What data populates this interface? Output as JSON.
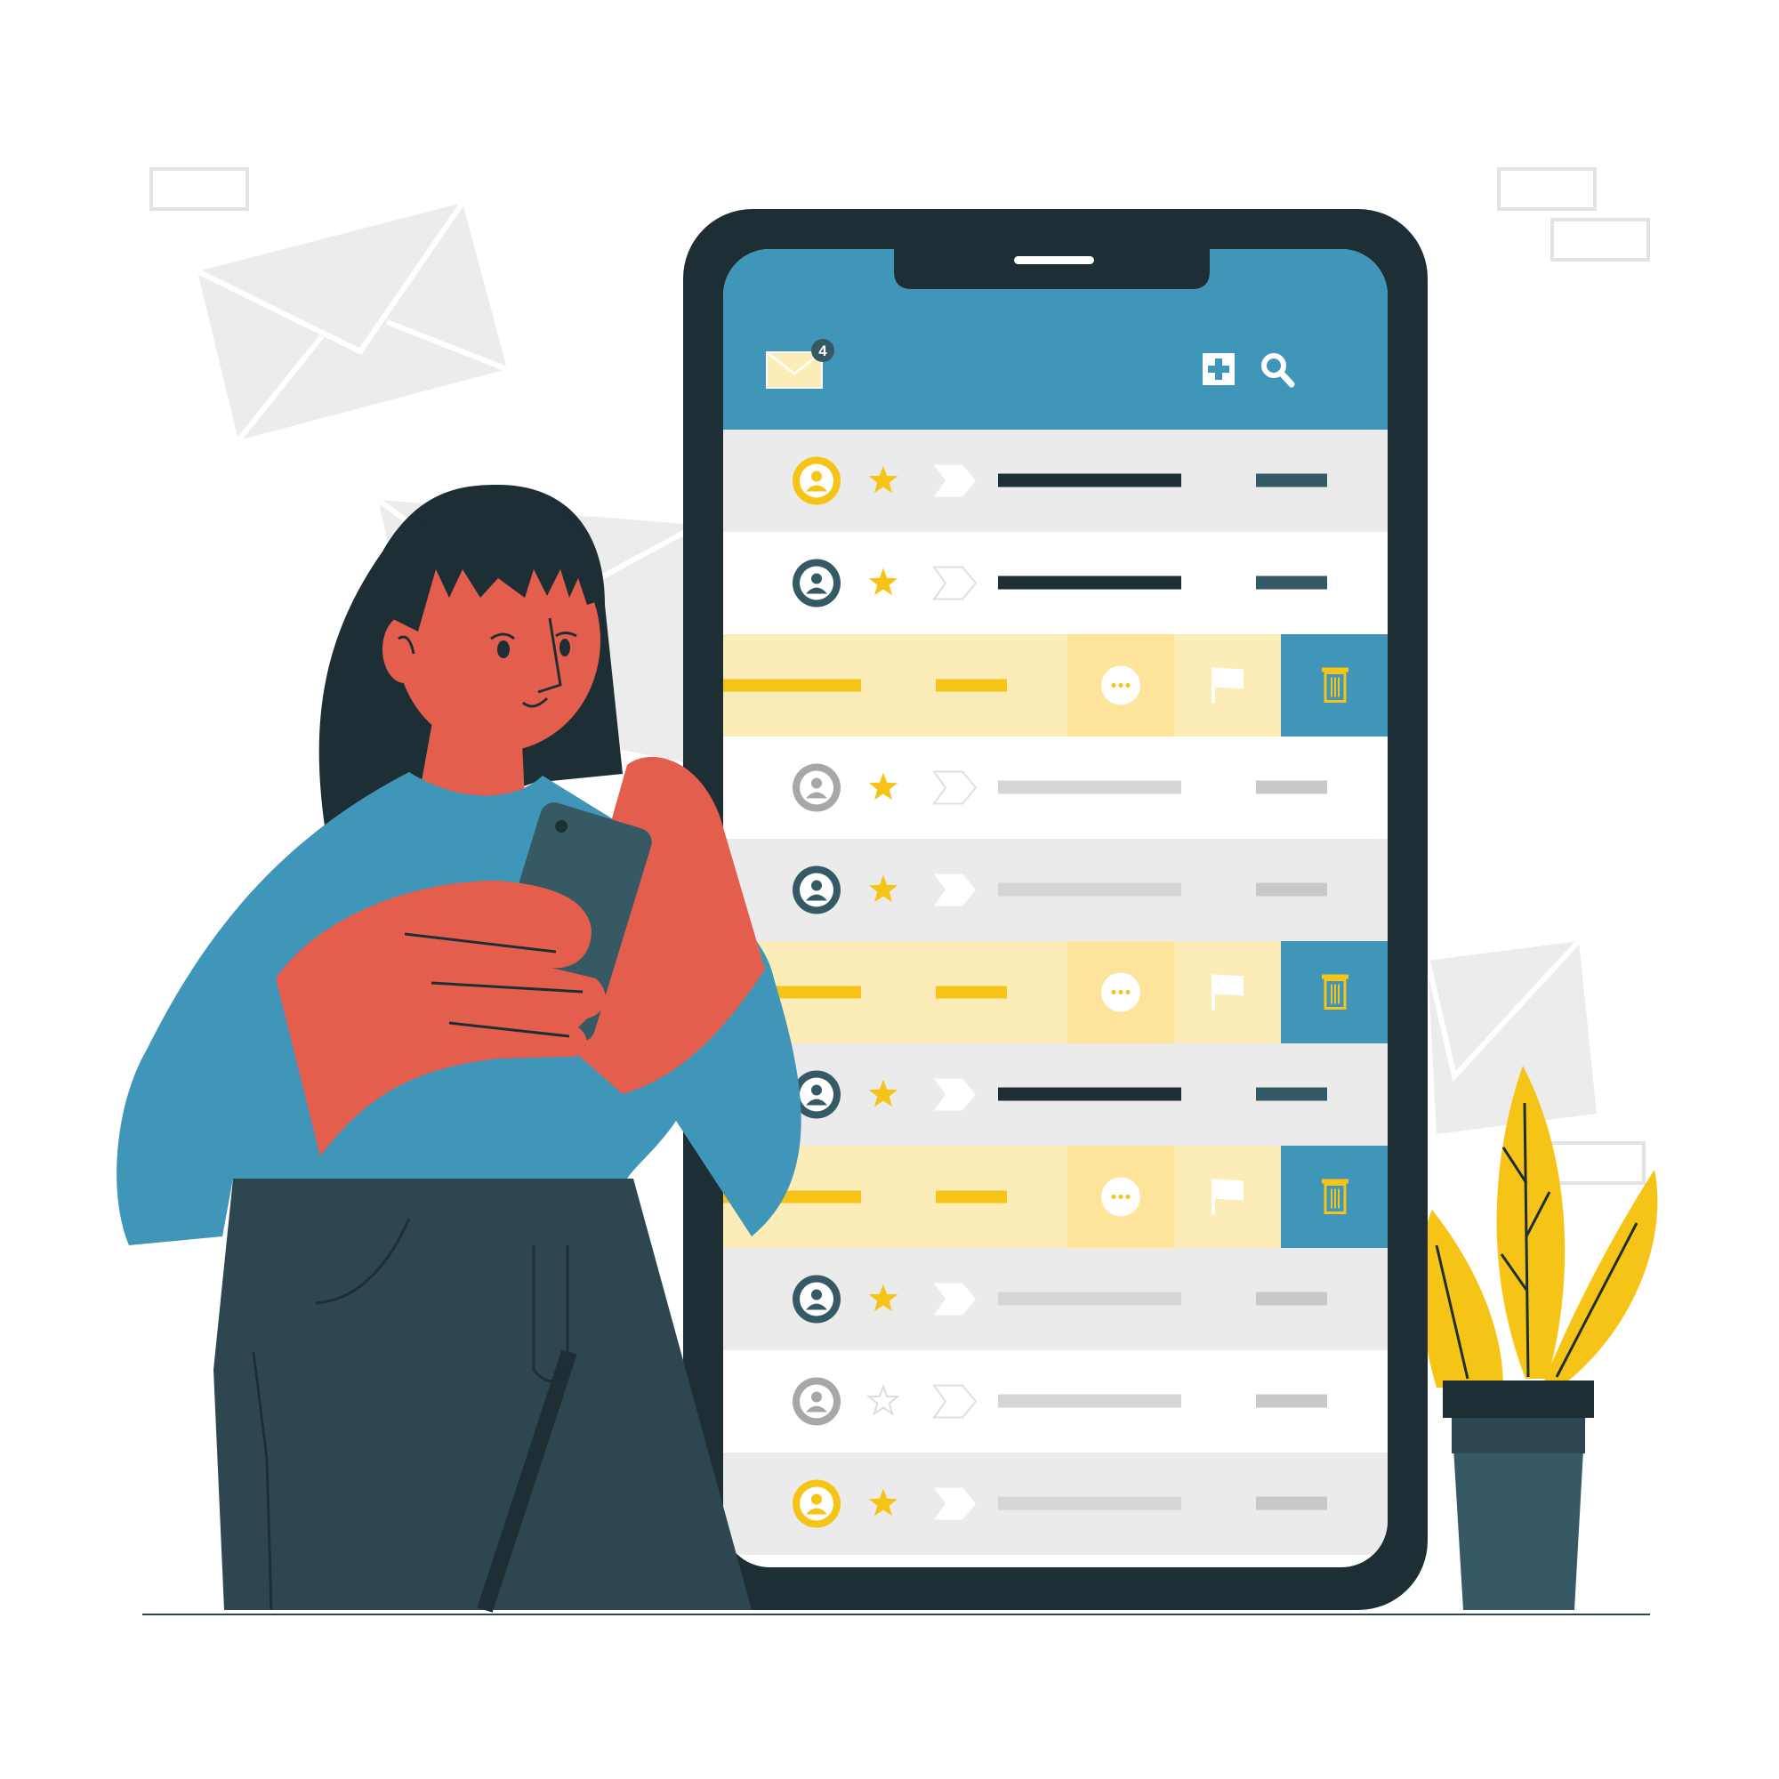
{
  "colors": {
    "phone_frame": "#1e2e35",
    "header_blue": "#3f96b8",
    "row_gray": "#ebebeb",
    "row_white": "#ffffff",
    "swipe_bg": "#fcedb8",
    "swipe_more_bg": "#fde49a",
    "delete_bg": "#3f96b8",
    "accent_yellow": "#f6c416",
    "dark_slate": "#355a66",
    "placeholder_gray": "#d6d6d6",
    "avatar_gray": "#a7a7a7",
    "skin": "#e45e4d",
    "hair": "#1e2e35",
    "sweater": "#3f96b8",
    "pants": "#2d4650",
    "pot": "#365964",
    "envelope_bg": "#ececec"
  },
  "header": {
    "unread_badge": "4",
    "icons": [
      "mail-icon",
      "compose-icon",
      "search-icon"
    ]
  },
  "rows": [
    {
      "kind": "message",
      "bg": "gray",
      "avatar": "yellow",
      "starred": true,
      "read": false
    },
    {
      "kind": "message",
      "bg": "white",
      "avatar": "dark",
      "starred": true,
      "read": false
    },
    {
      "kind": "swiped",
      "bg": "swipe",
      "actions": [
        "more-icon",
        "flag-icon",
        "trash-icon"
      ]
    },
    {
      "kind": "message",
      "bg": "white",
      "avatar": "gray",
      "starred": true,
      "read": true
    },
    {
      "kind": "message",
      "bg": "gray",
      "avatar": "dark",
      "starred": true,
      "read": true
    },
    {
      "kind": "swiped",
      "bg": "swipe",
      "actions": [
        "more-icon",
        "flag-icon",
        "trash-icon"
      ]
    },
    {
      "kind": "message",
      "bg": "gray",
      "avatar": "dark",
      "starred": true,
      "read": false
    },
    {
      "kind": "swiped",
      "bg": "swipe",
      "actions": [
        "more-icon",
        "flag-icon",
        "trash-icon"
      ]
    },
    {
      "kind": "message",
      "bg": "gray",
      "avatar": "dark",
      "starred": true,
      "read": true
    },
    {
      "kind": "message",
      "bg": "white",
      "avatar": "gray",
      "starred": false,
      "read": true
    },
    {
      "kind": "message",
      "bg": "gray",
      "avatar": "yellow",
      "starred": true,
      "read": true
    }
  ]
}
